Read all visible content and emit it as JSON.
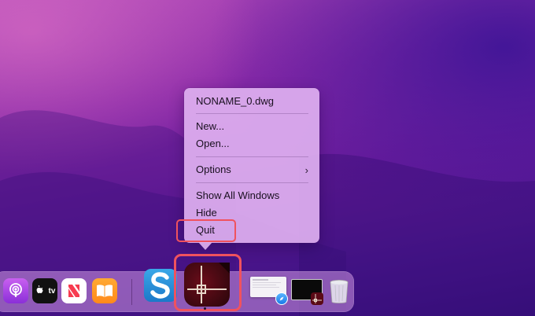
{
  "menu": {
    "title": "NONAME_0.dwg",
    "new": "New...",
    "open": "Open...",
    "options": "Options",
    "options_chevron": "›",
    "show_all": "Show All Windows",
    "hide": "Hide",
    "quit": "Quit"
  },
  "dock": {
    "apps": [
      "podcasts-icon",
      "apple-tv-icon",
      "news-icon",
      "books-icon",
      "snagit-icon",
      "autocad-icon",
      "window-thumbnail-icon",
      "autocad-window-thumbnail-icon",
      "trash-icon"
    ],
    "appletv_text": "tv"
  },
  "colors": {
    "highlight": "#f0525e",
    "menu_bg": "#deb0f0",
    "wallpaper": "#6a1c9c"
  }
}
